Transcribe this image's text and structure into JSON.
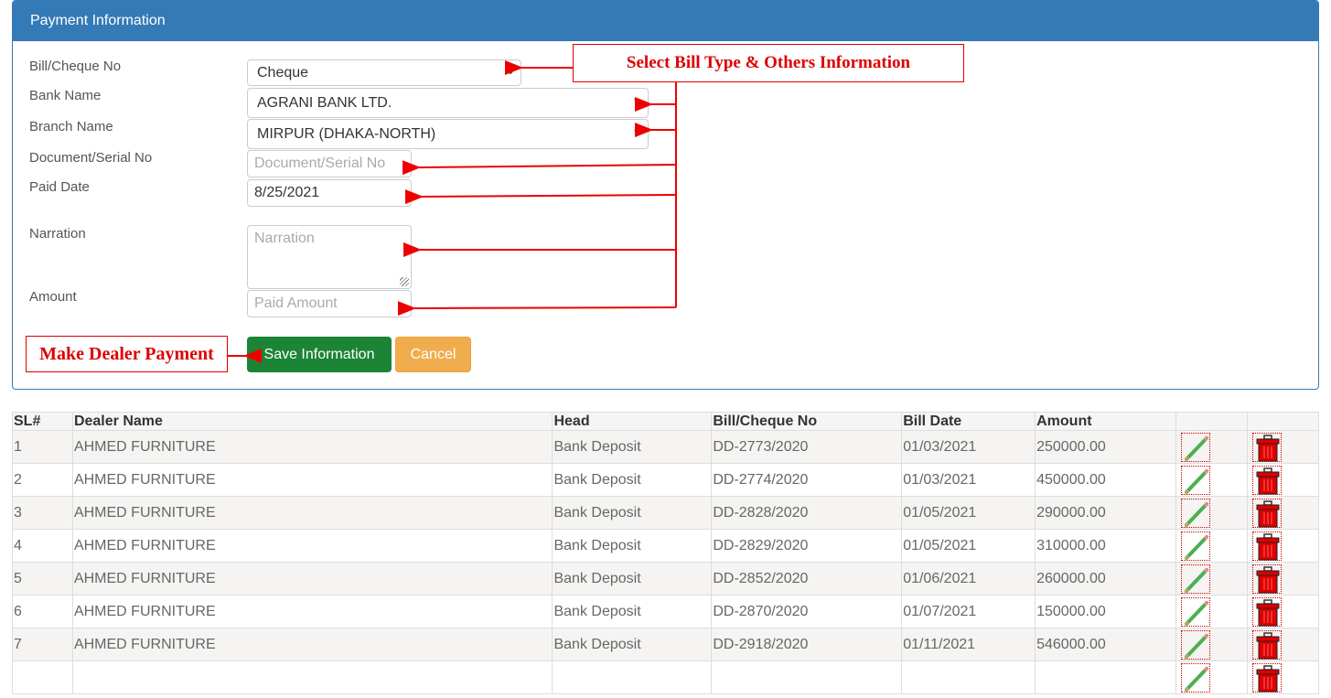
{
  "panel": {
    "title": "Payment Information",
    "fields": {
      "bill_type": {
        "label": "Bill/Cheque No",
        "value": "Cheque"
      },
      "bank_name": {
        "label": "Bank Name",
        "value": "AGRANI BANK LTD."
      },
      "branch_name": {
        "label": "Branch Name",
        "value": "MIRPUR (DHAKA-NORTH)"
      },
      "document_no": {
        "label": "Document/Serial No",
        "placeholder": "Document/Serial No"
      },
      "paid_date": {
        "label": "Paid Date",
        "value": "8/25/2021"
      },
      "narration": {
        "label": "Narration",
        "placeholder": "Narration"
      },
      "amount": {
        "label": "Amount",
        "placeholder": "Paid Amount"
      }
    },
    "buttons": {
      "save": "Save Information",
      "cancel": "Cancel"
    }
  },
  "annotations": {
    "select_info": "Select Bill Type & Others Information",
    "make_payment": "Make Dealer Payment",
    "color": "#dd0000"
  },
  "table": {
    "headers": [
      "SL#",
      "Dealer Name",
      "Head",
      "Bill/Cheque No",
      "Bill Date",
      "Amount",
      "",
      ""
    ],
    "rows": [
      {
        "sl": "1",
        "dealer": "AHMED FURNITURE",
        "head": "Bank Deposit",
        "bill_no": "DD-2773/2020",
        "date": "01/03/2021",
        "amount": "250000.00"
      },
      {
        "sl": "2",
        "dealer": "AHMED FURNITURE",
        "head": "Bank Deposit",
        "bill_no": "DD-2774/2020",
        "date": "01/03/2021",
        "amount": "450000.00"
      },
      {
        "sl": "3",
        "dealer": "AHMED FURNITURE",
        "head": "Bank Deposit",
        "bill_no": "DD-2828/2020",
        "date": "01/05/2021",
        "amount": "290000.00"
      },
      {
        "sl": "4",
        "dealer": "AHMED FURNITURE",
        "head": "Bank Deposit",
        "bill_no": "DD-2829/2020",
        "date": "01/05/2021",
        "amount": "310000.00"
      },
      {
        "sl": "5",
        "dealer": "AHMED FURNITURE",
        "head": "Bank Deposit",
        "bill_no": "DD-2852/2020",
        "date": "01/06/2021",
        "amount": "260000.00"
      },
      {
        "sl": "6",
        "dealer": "AHMED FURNITURE",
        "head": "Bank Deposit",
        "bill_no": "DD-2870/2020",
        "date": "01/07/2021",
        "amount": "150000.00"
      },
      {
        "sl": "7",
        "dealer": "AHMED FURNITURE",
        "head": "Bank Deposit",
        "bill_no": "DD-2918/2020",
        "date": "01/11/2021",
        "amount": "546000.00"
      },
      {
        "sl": "",
        "dealer": "",
        "head": "",
        "bill_no": "",
        "date": "",
        "amount": ""
      }
    ],
    "row_icons": {
      "edit": "pencil-icon",
      "delete": "trash-icon"
    }
  },
  "colors": {
    "primary": "#337ab7",
    "success": "#1c8435",
    "warning": "#f0ad4e"
  }
}
